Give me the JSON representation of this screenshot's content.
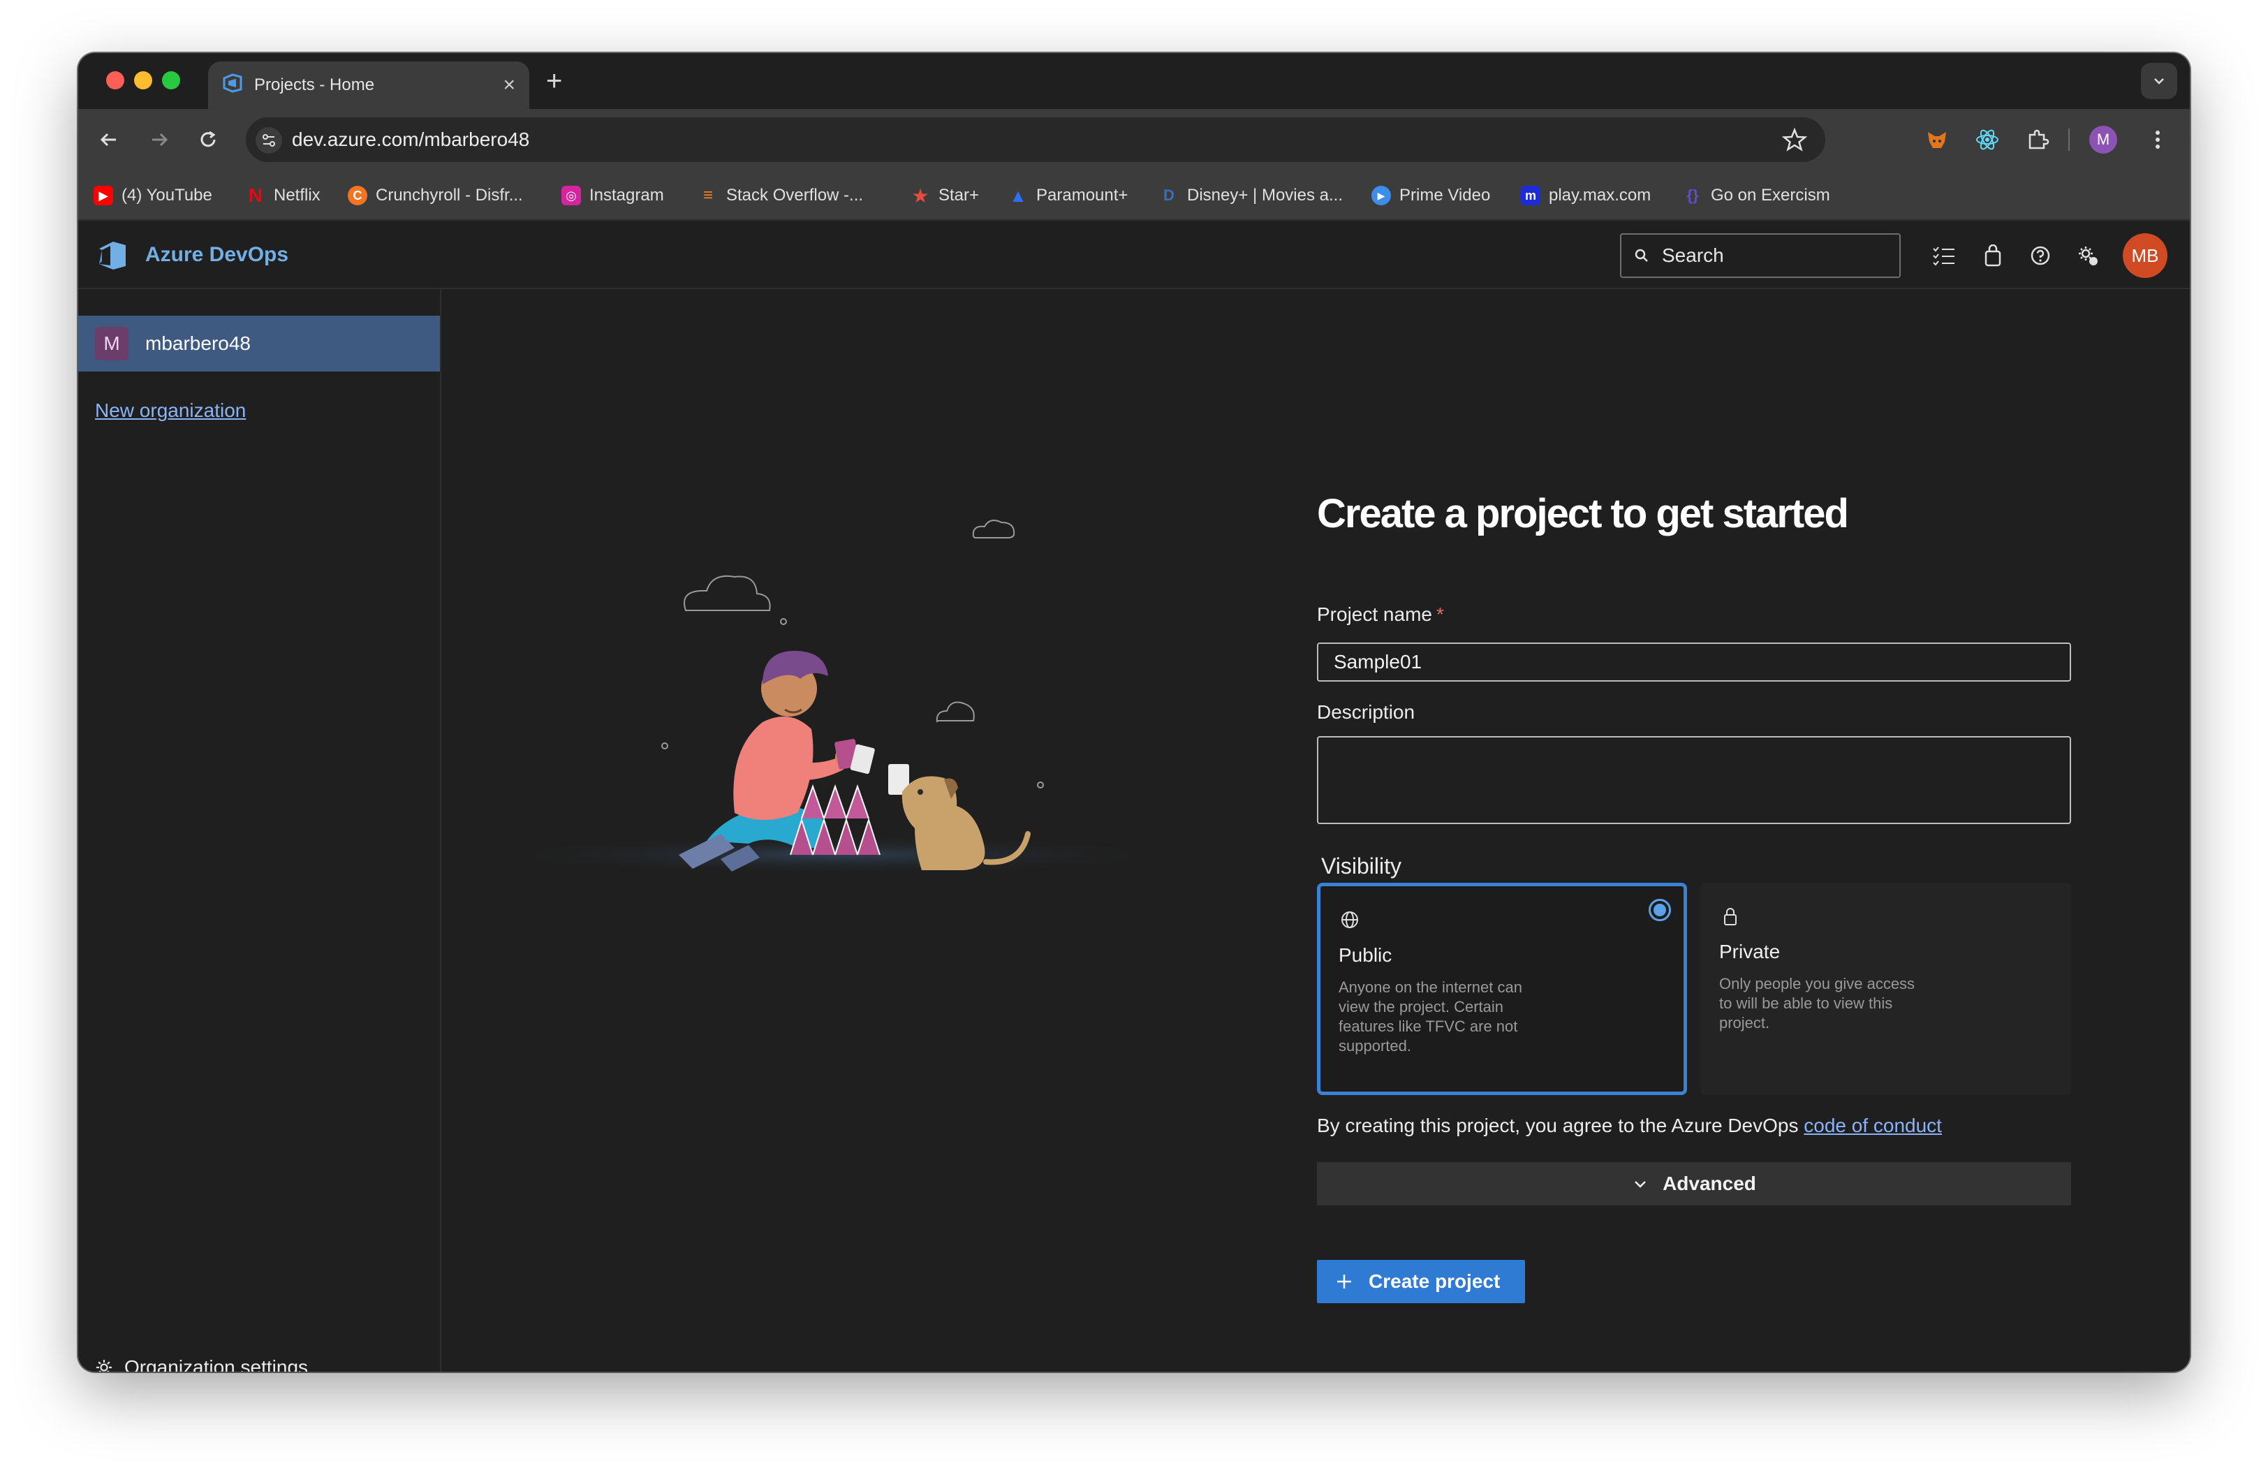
{
  "browser": {
    "tab": {
      "title": "Projects - Home",
      "close_glyph": "×",
      "icon": "azure-devops-icon"
    },
    "new_tab_glyph": "+",
    "address": {
      "url": "dev.azure.com/mbarbero48"
    },
    "profile_initial": "M",
    "bookmarks": [
      {
        "label": "(4) YouTube",
        "icon": "youtube-icon",
        "color": "#ff0000"
      },
      {
        "label": "Netflix",
        "icon": "netflix-icon",
        "color": "#e50914"
      },
      {
        "label": "Crunchyroll - Disfr...",
        "icon": "crunchyroll-icon",
        "color": "#f47521"
      },
      {
        "label": "Instagram",
        "icon": "instagram-icon",
        "color": "#d6249f"
      },
      {
        "label": "Stack Overflow -...",
        "icon": "stackoverflow-icon",
        "color": "#f48024"
      },
      {
        "label": "Star+",
        "icon": "star-plus-icon",
        "color": "#e84a3c"
      },
      {
        "label": "Paramount+",
        "icon": "paramount-icon",
        "color": "#2f6ef7"
      },
      {
        "label": "Disney+ | Movies a...",
        "icon": "disney-icon",
        "color": "#1f3b73"
      },
      {
        "label": "Prime Video",
        "icon": "prime-video-icon",
        "color": "#3d8ee8"
      },
      {
        "label": "play.max.com",
        "icon": "max-icon",
        "color": "#1c2bd8"
      },
      {
        "label": "Go on Exercism",
        "icon": "exercism-icon",
        "color": "#604fcd"
      }
    ]
  },
  "azure": {
    "brand": "Azure DevOps",
    "search_label": "Search",
    "user_initials": "MB",
    "accent": "#2f7ad3"
  },
  "sidebar": {
    "org_badge": "M",
    "org_name": "mbarbero48",
    "new_org_link": "New organization",
    "settings_label": "Organization settings"
  },
  "form": {
    "title": "Create a project to get started",
    "project_name_label": "Project name",
    "required_mark": "*",
    "project_name_value": "Sample01",
    "description_label": "Description",
    "description_value": "",
    "visibility_label": "Visibility",
    "visibility_options": [
      {
        "title": "Public",
        "desc": "Anyone on the internet can view the project. Certain features like TFVC are not supported.",
        "selected": true,
        "icon": "globe-icon"
      },
      {
        "title": "Private",
        "desc": "Only people you give access to will be able to view this project.",
        "selected": false,
        "icon": "lock-icon"
      }
    ],
    "agree_text": "By creating this project, you agree to the Azure DevOps ",
    "agree_link": "code of conduct",
    "advanced_label": "Advanced",
    "create_button": "Create project"
  }
}
